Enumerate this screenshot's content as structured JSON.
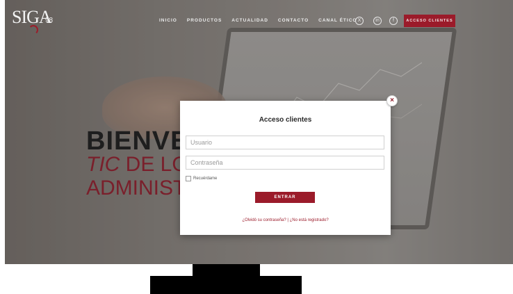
{
  "header": {
    "logo_text": "SIGA",
    "logo_suffix": "98",
    "nav": [
      "INICIO",
      "PRODUCTOS",
      "ACTUALIDAD",
      "CONTACTO",
      "CANAL ÉTICO"
    ],
    "social": [
      {
        "icon": "x-twitter-icon",
        "glyph": "X"
      },
      {
        "icon": "linkedin-icon",
        "glyph": "in"
      },
      {
        "icon": "facebook-icon",
        "glyph": "f"
      }
    ],
    "access_button": "ACCESO CLIENTES"
  },
  "hero": {
    "title": "BIENVE",
    "line2_italic": "TIC",
    "line2_rest": " DE LO",
    "line3": "ADMINIST"
  },
  "modal": {
    "title": "Acceso clientes",
    "username_placeholder": "Usuario",
    "password_placeholder": "Contraseña",
    "remember_label": "Recuérdame",
    "submit_label": "ENTRAR",
    "forgot_link": "¿Olvidó su contraseña?",
    "separator": " | ",
    "register_link": "¿No está registrado?",
    "close_glyph": "×"
  },
  "colors": {
    "brand": "#9b1b2a",
    "hero_text_dark": "#1e1e1e",
    "hero_text_accent": "#7a1f2b"
  }
}
